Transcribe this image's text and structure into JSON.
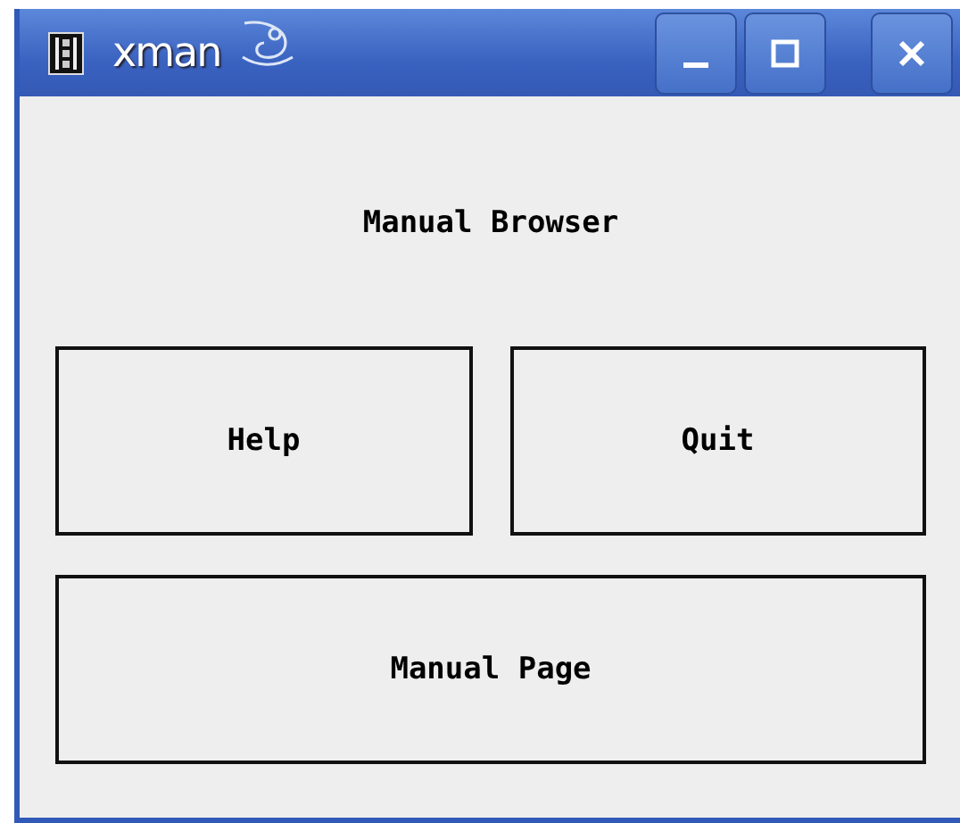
{
  "window": {
    "title": "xman"
  },
  "label": "Manual Browser",
  "buttons": [
    {
      "label": "Help"
    },
    {
      "label": "Quit"
    },
    {
      "label": "Manual Page"
    }
  ]
}
